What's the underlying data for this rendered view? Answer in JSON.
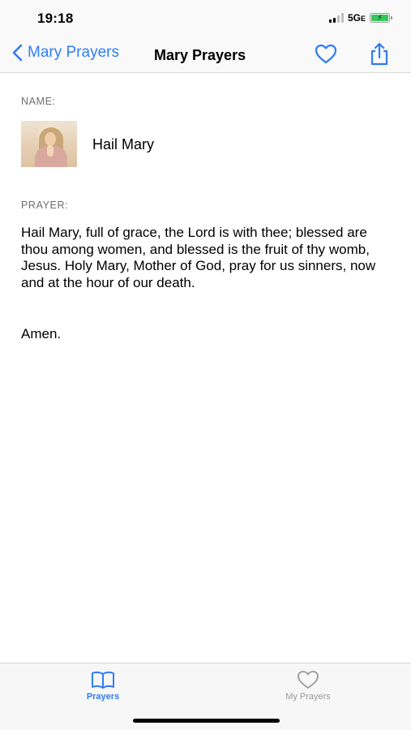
{
  "status_bar": {
    "time": "19:18",
    "network": "5G",
    "network_suffix": "E"
  },
  "nav": {
    "back_label": "Mary Prayers",
    "title": "Mary Prayers",
    "favorite_icon": "heart-outline-icon",
    "share_icon": "share-icon"
  },
  "detail": {
    "name_label": "NAME:",
    "name": "Hail Mary",
    "prayer_label": "PRAYER:",
    "prayer_text": "Hail Mary, full of grace, the Lord is with thee; blessed are thou among women, and blessed is the fruit of thy womb, Jesus. Holy Mary, Mother of God, pray for us sinners, now and at the hour of our death.",
    "amen": "Amen."
  },
  "tab_bar": {
    "tabs": [
      {
        "label": "Prayers",
        "icon": "book-icon",
        "selected": true
      },
      {
        "label": "My Prayers",
        "icon": "heart-outline-icon",
        "selected": false
      }
    ]
  },
  "colors": {
    "accent": "#2f7cf6",
    "inactive": "#9a9a9a",
    "battery": "#34c759"
  }
}
